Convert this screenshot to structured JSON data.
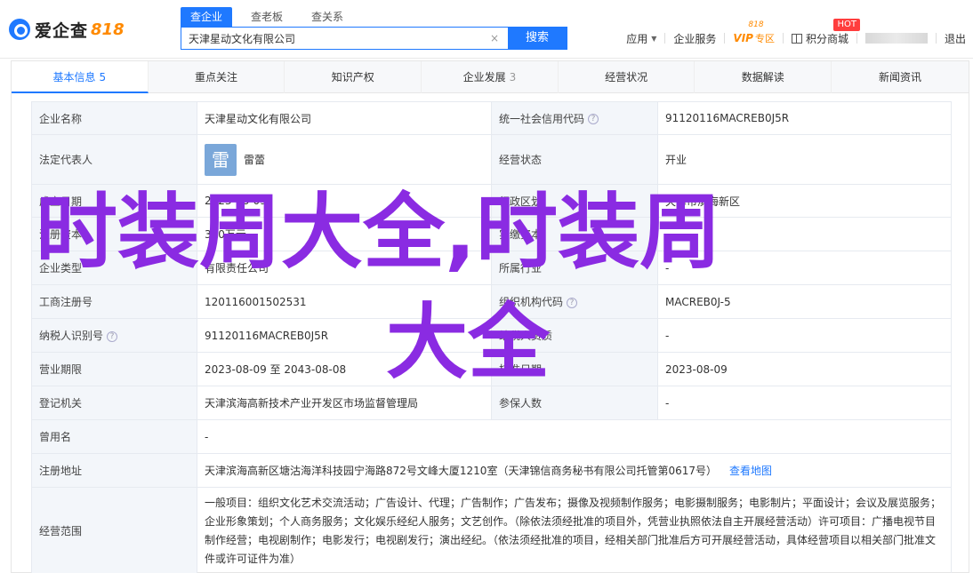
{
  "brand": {
    "name": "爱企查",
    "number": "818"
  },
  "search": {
    "tabs": [
      "查企业",
      "查老板",
      "查关系"
    ],
    "active_tab": 0,
    "value": "天津星动文化有限公司",
    "clear": "×",
    "button": "搜索"
  },
  "header_links": {
    "apps": "应用",
    "services": "企业服务",
    "vip": "VIP",
    "vip_sub": "专区",
    "vip_badge": "818",
    "points": "积分商城",
    "hot": "HOT",
    "logout": "退出"
  },
  "tabs": [
    {
      "label": "基本信息",
      "count": "5"
    },
    {
      "label": "重点关注",
      "count": ""
    },
    {
      "label": "知识产权",
      "count": ""
    },
    {
      "label": "企业发展",
      "count": "3"
    },
    {
      "label": "经营状况",
      "count": ""
    },
    {
      "label": "数据解读",
      "count": ""
    },
    {
      "label": "新闻资讯",
      "count": ""
    }
  ],
  "info": {
    "company_name_label": "企业名称",
    "company_name": "天津星动文化有限公司",
    "credit_code_label": "统一社会信用代码",
    "credit_code": "91120116MACREB0J5R",
    "legal_rep_label": "法定代表人",
    "legal_rep_avatar": "雷",
    "legal_rep": "雷蕾",
    "status_label": "经营状态",
    "status": "开业",
    "founded_label": "成立日期",
    "founded": "2023-08-09",
    "region_label": "行政区划",
    "region": "天津市滨海新区",
    "reg_capital_label": "注册资本",
    "reg_capital": "300万元",
    "paid_capital_label": "实缴资本",
    "paid_capital": "-",
    "type_label": "企业类型",
    "type": "有限责任公司",
    "industry_label": "所属行业",
    "industry": "-",
    "reg_no_label": "工商注册号",
    "reg_no": "120116001502531",
    "org_code_label": "组织机构代码",
    "org_code": "MACREB0J-5",
    "tax_id_label": "纳税人识别号",
    "tax_id": "91120116MACREB0J5R",
    "taxpayer_qual_label": "纳税人资质",
    "taxpayer_qual": "-",
    "term_label": "营业期限",
    "term": "2023-08-09 至 2043-08-08",
    "approved_label": "核准日期",
    "approved": "2023-08-09",
    "authority_label": "登记机关",
    "authority": "天津滨海高新技术产业开发区市场监督管理局",
    "insured_label": "参保人数",
    "insured": "-",
    "former_name_label": "曾用名",
    "former_name": "-",
    "address_label": "注册地址",
    "address": "天津滨海高新区塘沽海洋科技园宁海路872号文峰大厦1210室（天津锦信商务秘书有限公司托管第0617号）",
    "map_link": "查看地图",
    "scope_label": "经营范围",
    "scope": "一般项目：组织文化艺术交流活动；广告设计、代理；广告制作；广告发布；摄像及视频制作服务；电影摄制服务；电影制片；平面设计；会议及展览服务；企业形象策划；个人商务服务；文化娱乐经纪人服务；文艺创作。（除依法须经批准的项目外，凭营业执照依法自主开展经营活动）许可项目：广播电视节目制作经营；电视剧制作；电影发行；电视剧发行；演出经纪。（依法须经批准的项目，经相关部门批准后方可开展经营活动，具体经营项目以相关部门批准文件或许可证件为准）"
  },
  "overlay": {
    "line1": "时装周大全,时装周",
    "line2": "大全",
    "color": "#8a2be2"
  }
}
